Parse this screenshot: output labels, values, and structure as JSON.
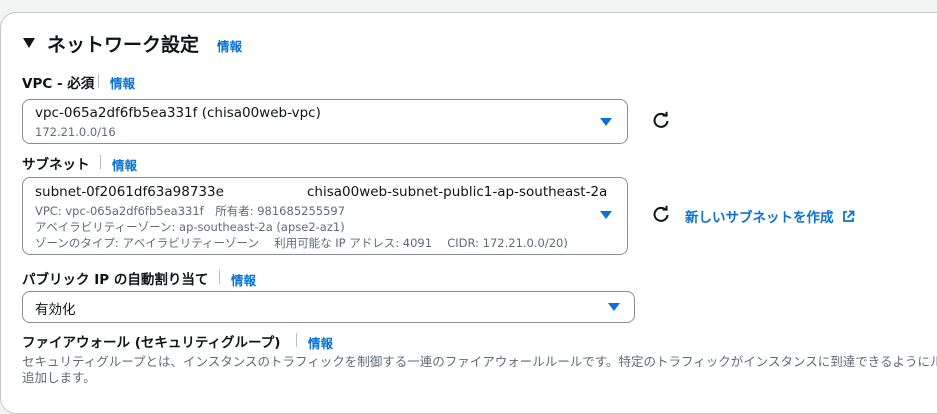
{
  "section": {
    "title": "ネットワーク設定",
    "info": "情報",
    "expand_icon": "caret-down-icon"
  },
  "vpc": {
    "label": "VPC - 必須",
    "info": "情報",
    "value": "vpc-065a2df6fb5ea331f (chisa00web-vpc)",
    "cidr": "172.21.0.0/16"
  },
  "subnet": {
    "label": "サブネット",
    "info": "情報",
    "id": "subnet-0f2061df63a98733e",
    "name": "chisa00web-subnet-public1-ap-southeast-2a",
    "line2": "VPC: vpc-065a2df6fb5ea331f　所有者: 981685255597",
    "line3": "アベイラビリティーゾーン: ap-southeast-2a (apse2-az1)",
    "line4": "ゾーンのタイプ: アベイラビリティーゾーン　 利用可能な IP アドレス: 4091　 CIDR: 172.21.0.0/20)",
    "new_link": "新しいサブネットを作成"
  },
  "public_ip": {
    "label": "パブリック IP の自動割り当て",
    "info": "情報",
    "value": "有効化"
  },
  "firewall": {
    "label": "ファイアウォール (セキュリティグループ)",
    "info": "情報",
    "desc1": "セキュリティグループとは、インスタンスのトラフィックを制御する一連のファイアウォールルールです。特定のトラフィックがインスタンスに到達できるようにルール",
    "desc2": "追加します。"
  },
  "colors": {
    "accent": "#0972d3",
    "text": "#0f141a",
    "muted": "#5f6b7a",
    "border": "#8c8c94"
  }
}
